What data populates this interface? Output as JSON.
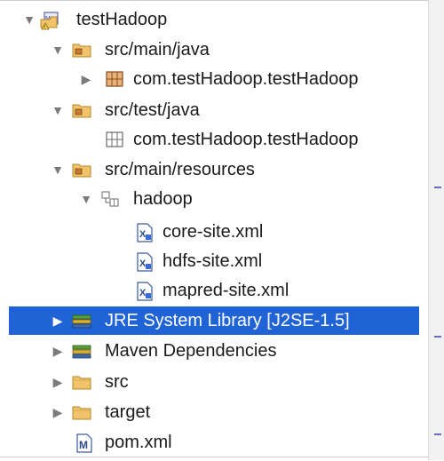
{
  "tree": {
    "project": {
      "label": "testHadoop",
      "badges": [
        "maven-badge",
        "warning-badge"
      ]
    },
    "src_main_java": {
      "label": "src/main/java"
    },
    "pkg_main": {
      "label": "com.testHadoop.testHadoop"
    },
    "src_test_java": {
      "label": "src/test/java"
    },
    "pkg_test": {
      "label": "com.testHadoop.testHadoop"
    },
    "src_main_resources": {
      "label": "src/main/resources"
    },
    "hadoop_folder": {
      "label": "hadoop"
    },
    "core_site": {
      "label": "core-site.xml"
    },
    "hdfs_site": {
      "label": "hdfs-site.xml"
    },
    "mapred_site": {
      "label": "mapred-site.xml"
    },
    "jre_library": {
      "label": "JRE System Library [J2SE-1.5]"
    },
    "maven_deps": {
      "label": "Maven Dependencies"
    },
    "src_folder": {
      "label": "src"
    },
    "target_folder": {
      "label": "target"
    },
    "pom": {
      "label": "pom.xml"
    }
  },
  "colors": {
    "selection": "#1f63d6",
    "folder": "#e8b85b",
    "package": "#b86a2a",
    "library": "#3b7a3b"
  }
}
